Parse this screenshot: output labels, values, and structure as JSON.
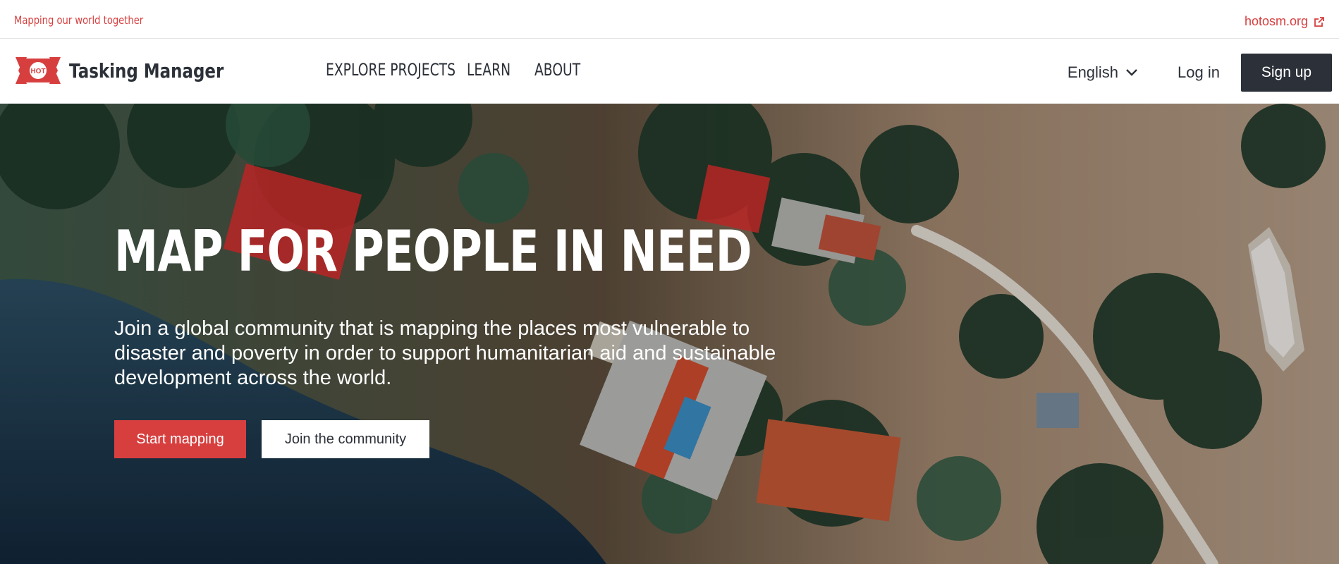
{
  "top_bar": {
    "tagline": "Mapping our world together",
    "external_link": "hotosm.org"
  },
  "nav": {
    "brand_badge": "HOT",
    "brand_name": "Tasking Manager",
    "links": [
      "EXPLORE PROJECTS",
      "LEARN",
      "ABOUT"
    ],
    "language": "English",
    "login": "Log in",
    "signup": "Sign up"
  },
  "hero": {
    "title": "MAP FOR PEOPLE IN NEED",
    "subtitle": "Join a global community that is mapping the places most vulnerable to disaster and poverty in order to support humanitarian aid and sustainable development across the world.",
    "primary_button": "Start mapping",
    "secondary_button": "Join the community"
  },
  "colors": {
    "accent": "#d73f3f",
    "dark": "#2c3038",
    "white": "#ffffff"
  },
  "icons": {
    "logo": "hot-logo-icon",
    "external": "external-link-icon",
    "language_chevron": "chevron-down-icon"
  }
}
